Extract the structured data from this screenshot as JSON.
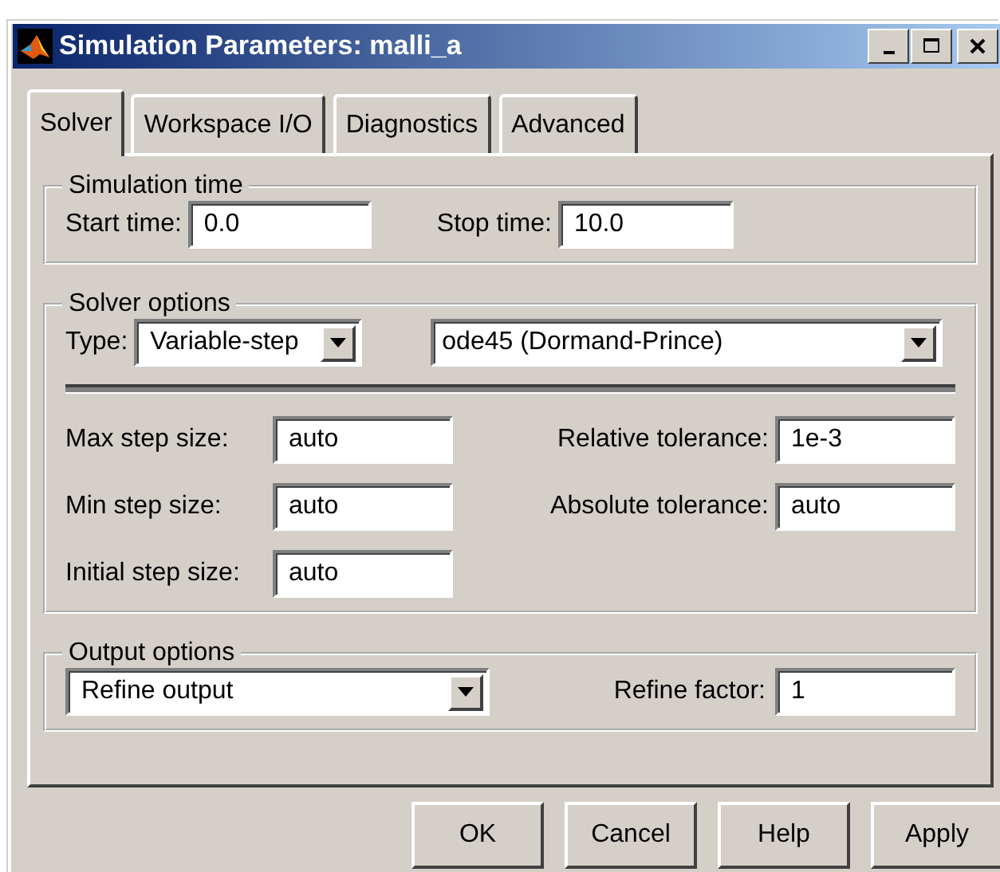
{
  "window": {
    "title": "Simulation Parameters: malli_a"
  },
  "tabs": [
    {
      "label": "Solver",
      "selected": true
    },
    {
      "label": "Workspace I/O",
      "selected": false
    },
    {
      "label": "Diagnostics",
      "selected": false
    },
    {
      "label": "Advanced",
      "selected": false
    }
  ],
  "simulation_time": {
    "legend": "Simulation time",
    "start": {
      "label": "Start time:",
      "value": "0.0"
    },
    "stop": {
      "label": "Stop time:",
      "value": "10.0"
    }
  },
  "solver_options": {
    "legend": "Solver options",
    "type_label": "Type:",
    "type": "Variable-step",
    "solver": "ode45 (Dormand-Prince)",
    "fields_left": [
      {
        "label": "Max step size:",
        "value": "auto"
      },
      {
        "label": "Min step size:",
        "value": "auto"
      },
      {
        "label": "Initial step size:",
        "value": "auto"
      }
    ],
    "fields_right": [
      {
        "label": "Relative tolerance:",
        "value": "1e-3"
      },
      {
        "label": "Absolute tolerance:",
        "value": "auto"
      }
    ]
  },
  "output_options": {
    "legend": "Output options",
    "mode": "Refine output",
    "refine": {
      "label": "Refine factor:",
      "value": "1"
    }
  },
  "buttons": [
    "OK",
    "Cancel",
    "Help",
    "Apply"
  ]
}
